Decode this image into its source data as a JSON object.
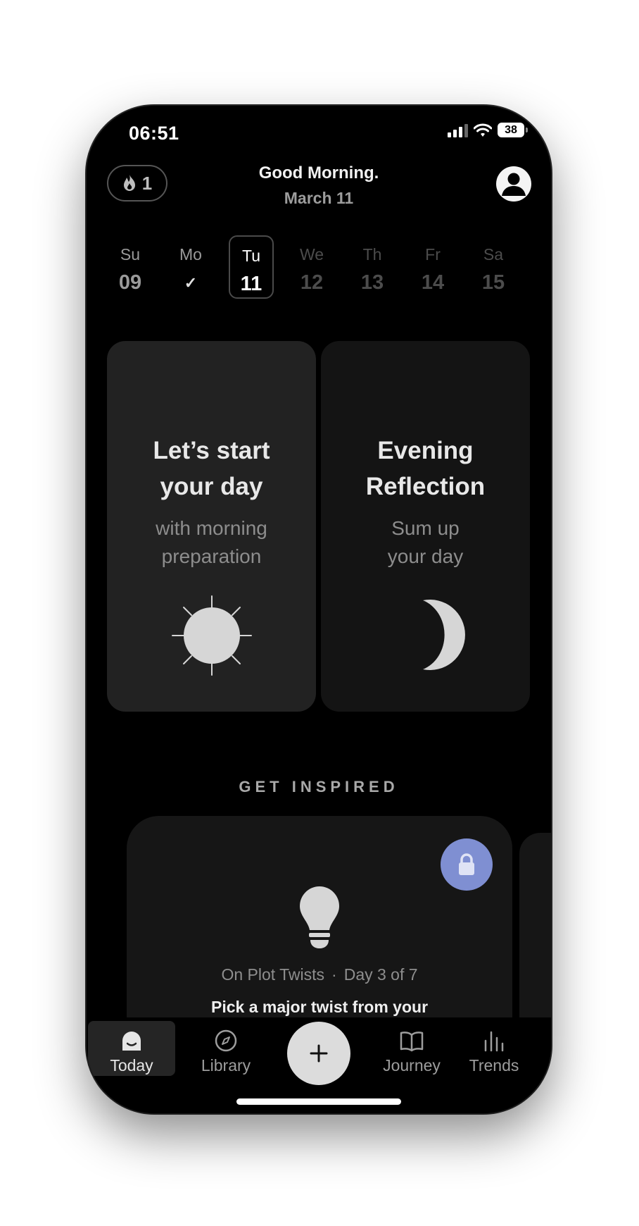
{
  "status_bar": {
    "time": "06:51",
    "battery": "38"
  },
  "header": {
    "streak_count": "1",
    "greeting": "Good Morning.",
    "date": "March 11"
  },
  "week": [
    {
      "name": "Su",
      "num": "09",
      "state": "past"
    },
    {
      "name": "Mo",
      "num": "✓",
      "state": "past-complete"
    },
    {
      "name": "Tu",
      "num": "11",
      "state": "today"
    },
    {
      "name": "We",
      "num": "12",
      "state": "future"
    },
    {
      "name": "Th",
      "num": "13",
      "state": "future"
    },
    {
      "name": "Fr",
      "num": "14",
      "state": "future"
    },
    {
      "name": "Sa",
      "num": "15",
      "state": "future"
    }
  ],
  "cards": {
    "morning": {
      "title_line1": "Let’s start",
      "title_line2": "your day",
      "sub_line1": "with morning",
      "sub_line2": "preparation",
      "icon": "sun-icon"
    },
    "evening": {
      "title_line1": "Evening",
      "title_line2": "Reflection",
      "sub_line1": "Sum up",
      "sub_line2": "your day",
      "icon": "moon-icon"
    }
  },
  "inspired": {
    "title": "GET INSPIRED",
    "card": {
      "series": "On Plot Twists",
      "separator": "·",
      "progress": "Day 3 of 7",
      "prompt": "Pick a major twist from your",
      "locked": true,
      "icon": "lightbulb-icon"
    }
  },
  "tabs": {
    "today": "Today",
    "library": "Library",
    "add_icon": "plus-icon",
    "journey": "Journey",
    "trends": "Trends"
  },
  "colors": {
    "background": "#000000",
    "card_morning": "#222222",
    "card_evening": "#141414",
    "lock_accent": "#7f8fd2"
  }
}
